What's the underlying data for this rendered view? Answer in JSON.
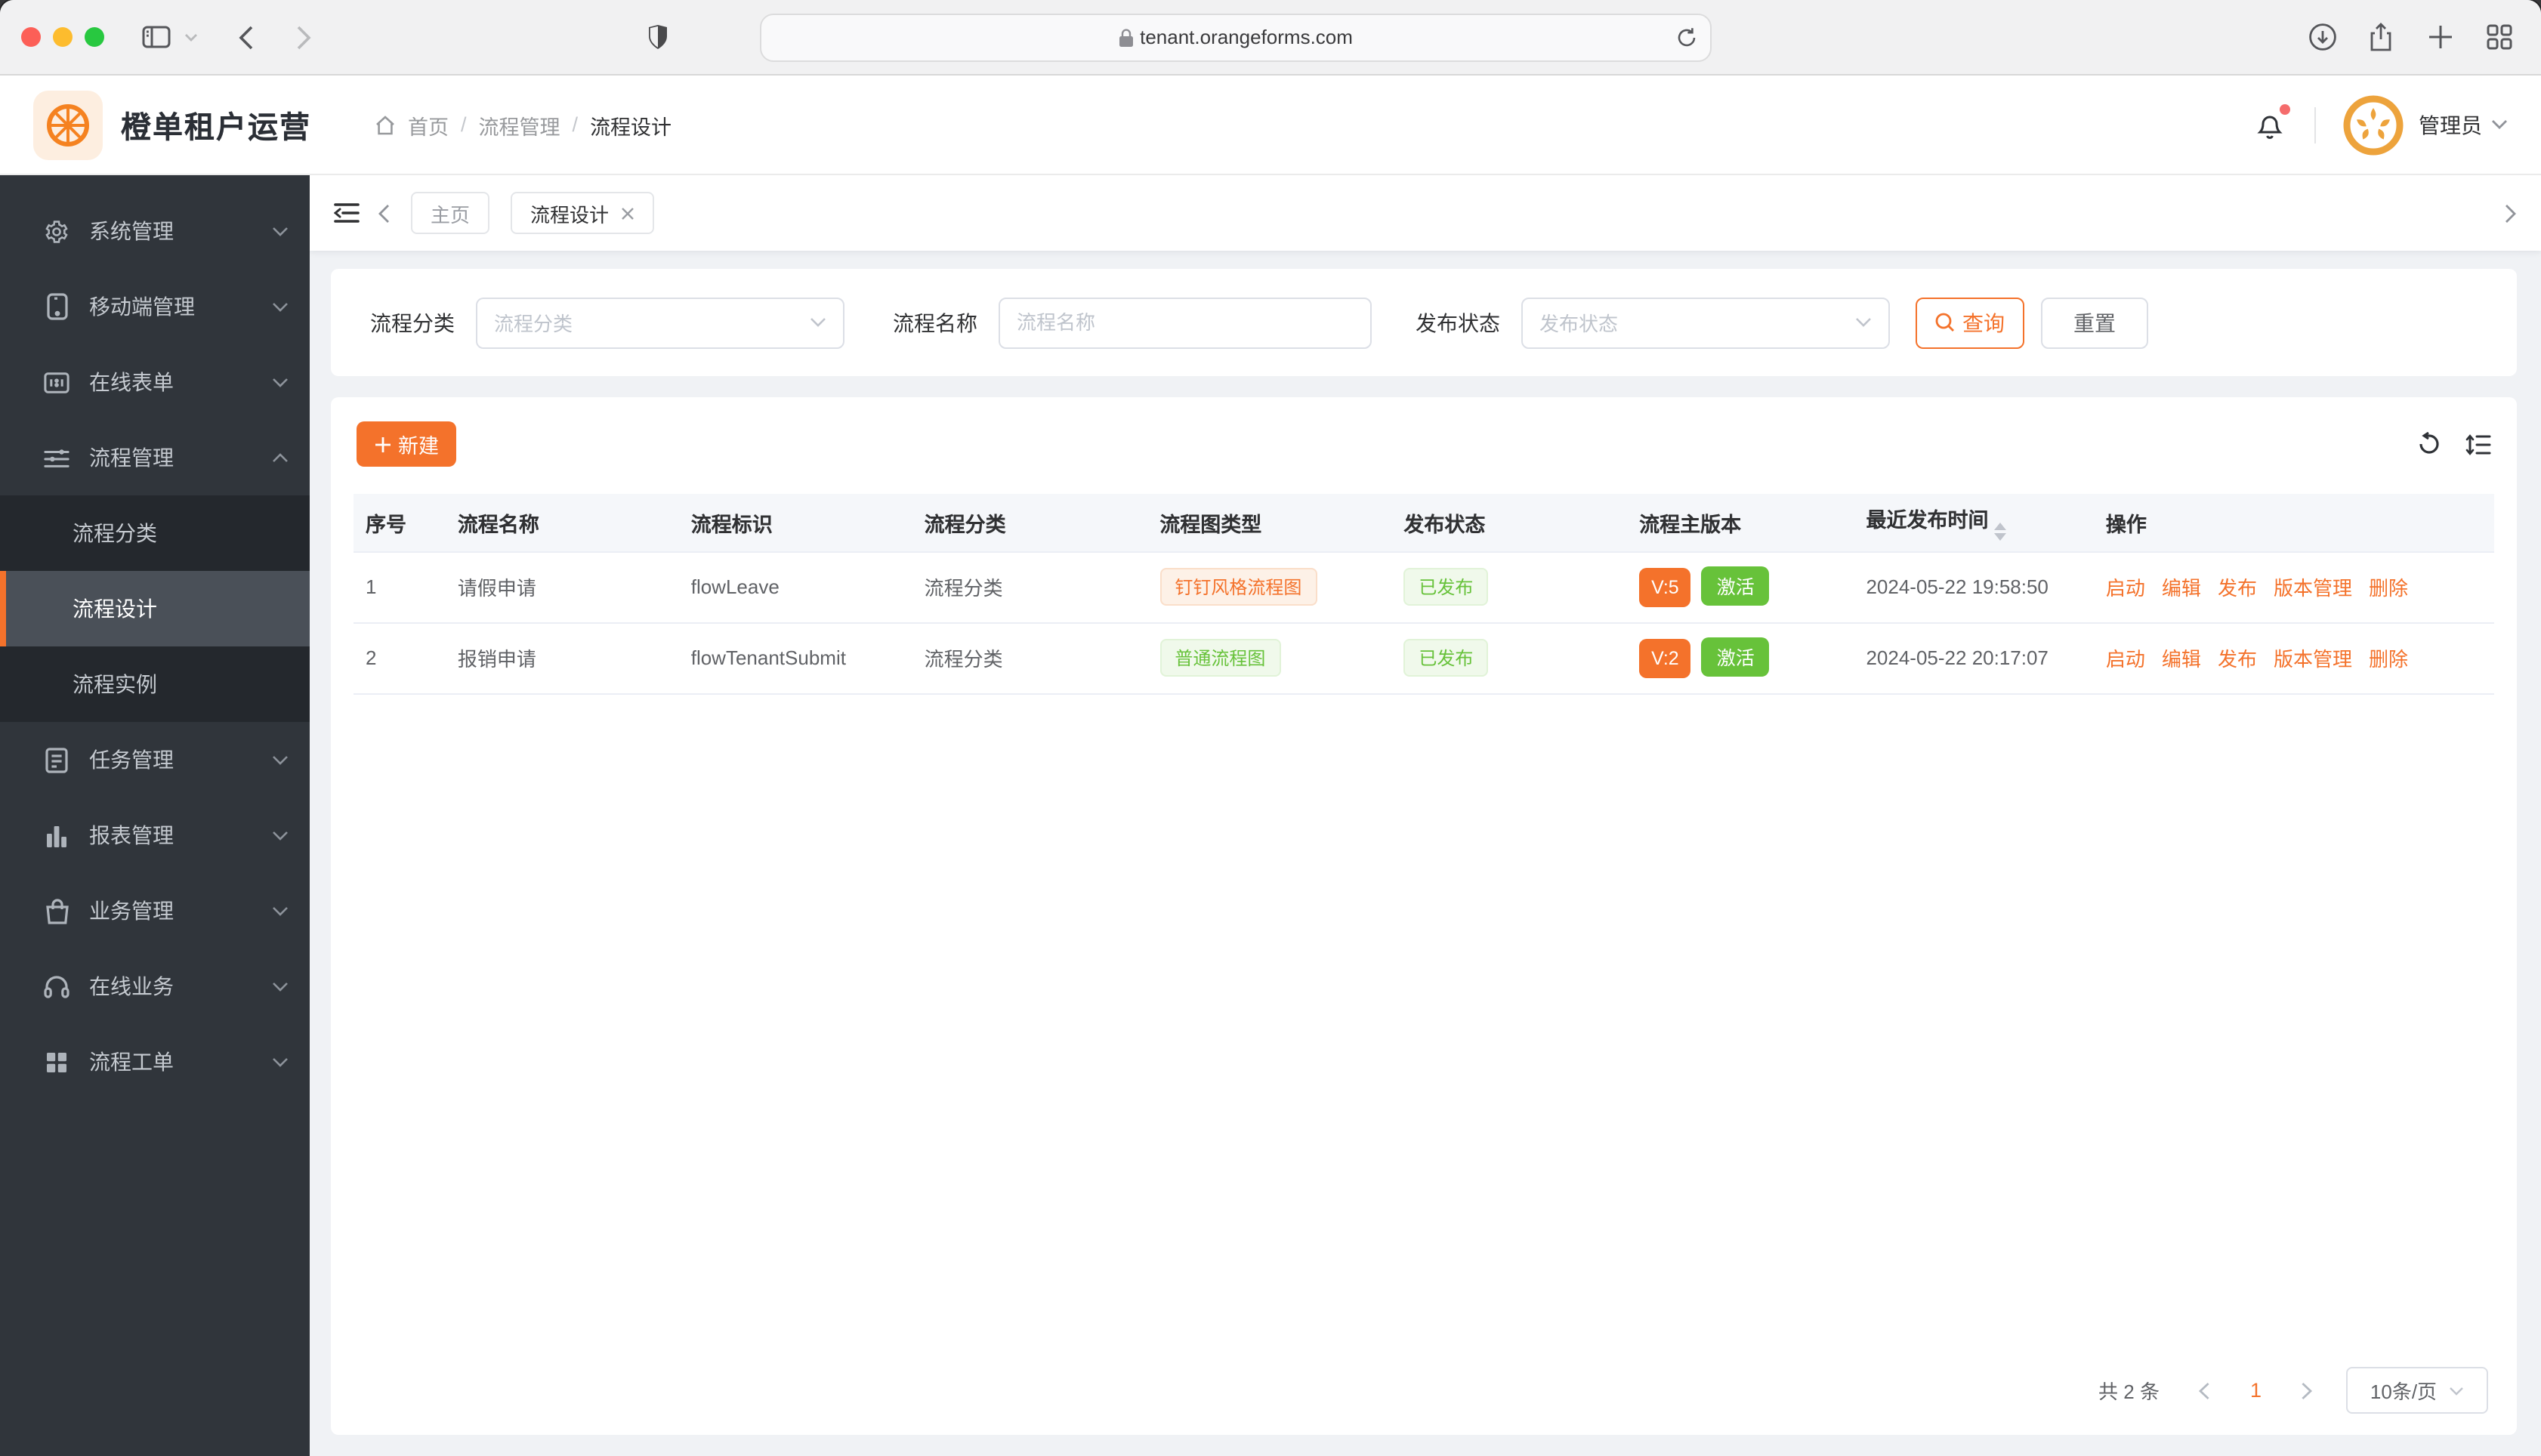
{
  "browser": {
    "url": "tenant.orangeforms.com",
    "icons": [
      "sidebar-toggle-icon",
      "chevron-down-icon",
      "back-icon",
      "forward-icon",
      "shield-icon",
      "lock-icon",
      "reload-icon",
      "download-icon",
      "share-icon",
      "new-tab-icon",
      "tab-overview-icon"
    ]
  },
  "header": {
    "app_title": "橙单租户运营",
    "breadcrumb": {
      "items": [
        "首页",
        "流程管理",
        "流程设计"
      ],
      "separator": "/"
    },
    "user_name": "管理员"
  },
  "sidebar": {
    "items": [
      {
        "label": "系统管理",
        "icon": "gear-icon"
      },
      {
        "label": "移动端管理",
        "icon": "mobile-icon"
      },
      {
        "label": "在线表单",
        "icon": "form-icon"
      },
      {
        "label": "流程管理",
        "icon": "sliders-icon",
        "expanded": true,
        "children": [
          {
            "label": "流程分类"
          },
          {
            "label": "流程设计",
            "active": true
          },
          {
            "label": "流程实例"
          }
        ]
      },
      {
        "label": "任务管理",
        "icon": "task-icon"
      },
      {
        "label": "报表管理",
        "icon": "chart-icon"
      },
      {
        "label": "业务管理",
        "icon": "bag-icon"
      },
      {
        "label": "在线业务",
        "icon": "headset-icon"
      },
      {
        "label": "流程工单",
        "icon": "grid-icon"
      }
    ]
  },
  "tabs": [
    {
      "label": "主页",
      "active": false,
      "closable": false
    },
    {
      "label": "流程设计",
      "active": true,
      "closable": true
    }
  ],
  "filters": {
    "category_label": "流程分类",
    "category_placeholder": "流程分类",
    "name_label": "流程名称",
    "name_placeholder": "流程名称",
    "name_value": "",
    "status_label": "发布状态",
    "status_placeholder": "发布状态",
    "search_label": "查询",
    "reset_label": "重置"
  },
  "toolbar": {
    "create_label": "新建"
  },
  "table": {
    "columns": [
      "序号",
      "流程名称",
      "流程标识",
      "流程分类",
      "流程图类型",
      "发布状态",
      "流程主版本",
      "最近发布时间",
      "操作"
    ],
    "sorted_column": "最近发布时间",
    "rows": [
      {
        "index": "1",
        "name": "请假申请",
        "key": "flowLeave",
        "category": "流程分类",
        "diagram_type": "钉钉风格流程图",
        "diagram_type_color": "orange",
        "publish_status": "已发布",
        "version": "V:5",
        "version_status": "激活",
        "published_at": "2024-05-22 19:58:50",
        "actions": [
          "启动",
          "编辑",
          "发布",
          "版本管理",
          "删除"
        ]
      },
      {
        "index": "2",
        "name": "报销申请",
        "key": "flowTenantSubmit",
        "category": "流程分类",
        "diagram_type": "普通流程图",
        "diagram_type_color": "green",
        "publish_status": "已发布",
        "version": "V:2",
        "version_status": "激活",
        "published_at": "2024-05-22 20:17:07",
        "actions": [
          "启动",
          "编辑",
          "发布",
          "版本管理",
          "删除"
        ]
      }
    ]
  },
  "pagination": {
    "total": "共 2 条",
    "current_page": "1",
    "page_size": "10条/页"
  },
  "colors": {
    "accent": "#F4722B",
    "success": "#67C23A",
    "sidebar_bg": "#30353B",
    "sidebar_submenu_bg": "#24282D",
    "sidebar_active_bg": "#4A5058",
    "content_bg": "#F0F2F5",
    "table_header_bg": "#F5F7FA",
    "tag_light_orange_bg": "#FDF1E7",
    "tag_light_green_bg": "#F0F9EB"
  }
}
